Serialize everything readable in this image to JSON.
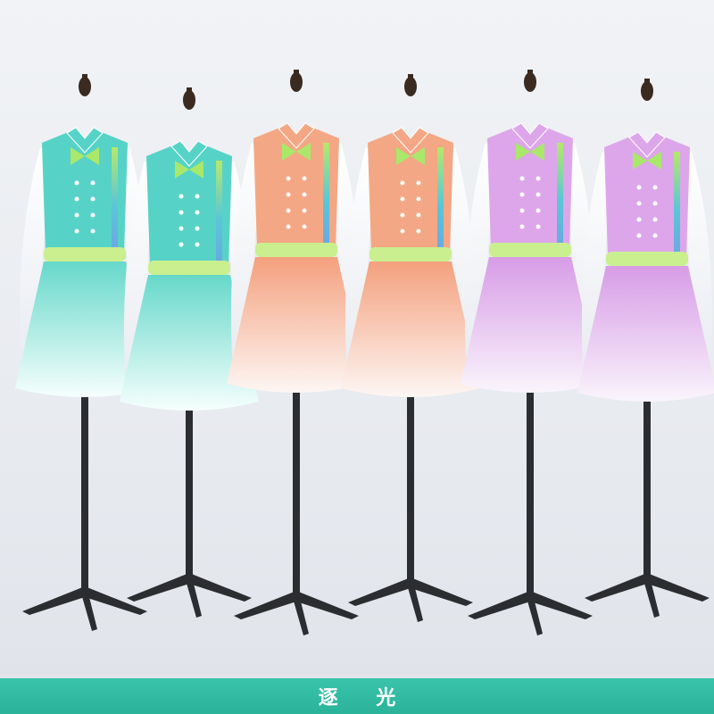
{
  "caption": {
    "text": "逐  光"
  },
  "colors": {
    "teal": "#56d3c6",
    "orange": "#f4a784",
    "lilac": "#dda6ea",
    "caption_bar": "#2fb7a0",
    "stand": "#2b2d30"
  },
  "outfits": [
    {
      "name": "boy-teal-suit",
      "style": "suit",
      "color": "teal"
    },
    {
      "name": "girl-teal-dress",
      "style": "dress",
      "color": "teal"
    },
    {
      "name": "boy-orange-suit",
      "style": "suit",
      "color": "orange"
    },
    {
      "name": "girl-orange-dress",
      "style": "dress",
      "color": "orange"
    },
    {
      "name": "boy-lilac-suit",
      "style": "suit",
      "color": "lilac"
    },
    {
      "name": "girl-lilac-dress",
      "style": "dress",
      "color": "lilac"
    }
  ]
}
